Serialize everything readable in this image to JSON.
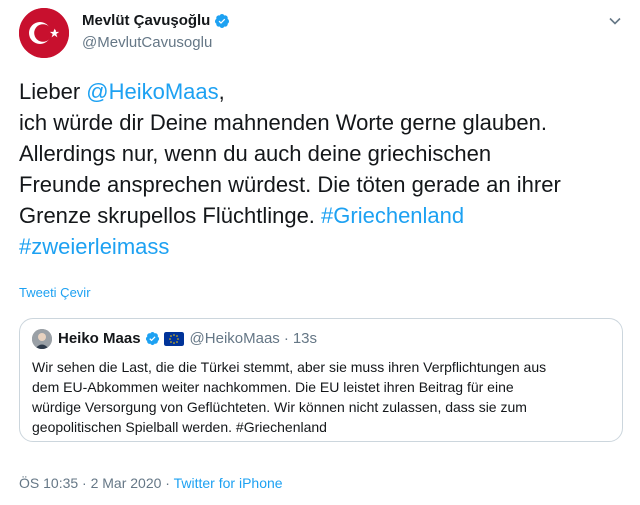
{
  "author": {
    "name": "Mevlüt Çavuşoğlu",
    "handle": "@MevlutCavusoglu"
  },
  "tweet": {
    "line1_prefix": "Lieber ",
    "mention": "@HeikoMaas",
    "line1_suffix": ",",
    "line2": "ich würde dir Deine mahnenden Worte gerne glauben.",
    "line3": "Allerdings nur, wenn du auch deine griechischen",
    "line4": "Freunde ansprechen würdest. Die töten gerade an ihrer",
    "line5_text": "Grenze skrupellos Flüchtlinge. ",
    "hashtag1": "#Griechenland",
    "hashtag2": "#zweierleimass"
  },
  "translate_label": "Tweeti Çevir",
  "quoted": {
    "name": "Heiko Maas",
    "handle": "@HeikoMaas",
    "separator": "·",
    "time": "13s",
    "line1": "Wir sehen die Last, die die Türkei stemmt, aber sie muss ihren Verpflichtungen aus",
    "line2": "dem EU-Abkommen weiter nachkommen. Die EU leistet ihren Beitrag für eine",
    "line3": "würdige Versorgung von Geflüchteten. Wir können nicht zulassen, dass sie zum",
    "line4": "geopolitischen Spielball werden. #Griechenland"
  },
  "meta": {
    "timestamp": "ÖS 10:35 · 2 Mar 2020 · ",
    "source": "Twitter for iPhone"
  },
  "colors": {
    "accent": "#1da1f2",
    "avatar_red": "#c8102e",
    "secondary_text": "#657786",
    "border": "#ccd6dd"
  }
}
